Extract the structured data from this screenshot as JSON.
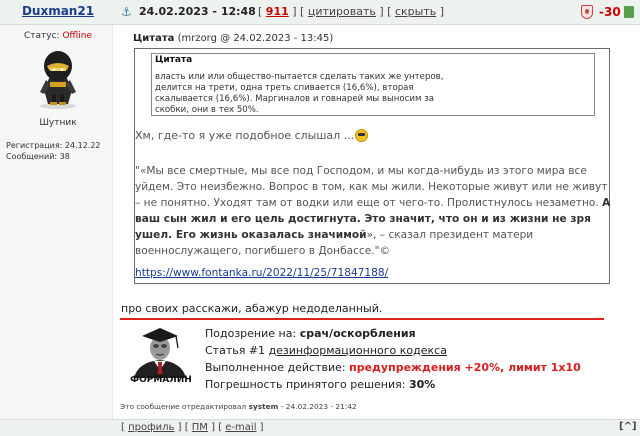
{
  "header": {
    "author": "Duxman21",
    "anchor": "⚓",
    "date": "24.02.2023 - 12:48",
    "post_num": "911",
    "quote_label": "цитировать",
    "hide_label": "скрыть",
    "score": "-30"
  },
  "user": {
    "status_label": "Статус:",
    "status_value": "Offline",
    "rank": "Шутник",
    "reg_line": "Регистрация: 24.12.22",
    "msgs_line": "Сообщений: 38"
  },
  "quote": {
    "title": "Цитата",
    "meta": "(mrzorg @ 24.02.2023 - 13:45)",
    "inner_title": "Цитата",
    "inner_text": "власть или или общество-пытается сделать таких же унтеров, делится на трети, одна треть спивается (16,6%), вторая скалывается (16,6%). Маргиналов и говнарей мы выносим за скобки, они в тех 50%.",
    "hm": "Хм, где-то я уже подобное слышал ...",
    "p1": "\"«Мы все смертные, мы все под Господом, и мы когда-нибудь из этого мира все уйдем. Это неизбежно. Вопрос в том, как мы жили. Некоторые живут или не живут – не понятно. Уходят там от водки или еще от чего-то. Пролистнулось незаметно.",
    "p1_bold": "А ваш сын жил и его цель достигнута. Это значит, что он и из жизни не зря ушел. Его жизнь оказалась значимой",
    "p1_end": "», – сказал президент матери военнослужащего, погибшего в Донбассе.\"©",
    "link": "https://www.fontanka.ru/2022/11/25/71847188/"
  },
  "reply": "про своих расскажи, абажур недоделанный.",
  "formalin": {
    "label": "ФОРМАЛИН",
    "l1_pre": "Подозрение на:",
    "l1_val": "срач/оскорбления",
    "l2_pre": "Статья #1",
    "l2_link": "дезинформационного кодекса",
    "l3_pre": "Выполненное действие:",
    "l3_val": "предупреждения +20%, лимит 1x10",
    "l4_pre": "Погрешность принятого решения:",
    "l4_val": "30%"
  },
  "edited": {
    "pre": "Это сообщение отредактировал",
    "user": "system",
    "time": "- 24.02.2023 - 21:42"
  },
  "footer": {
    "profile": "профиль",
    "pm": "ПМ",
    "email": "e-mail",
    "top": "[^]"
  },
  "colors": {
    "accent_red": "#cc0000",
    "link_blue": "#1a3d8f",
    "header_bg": "#eef2ef"
  }
}
